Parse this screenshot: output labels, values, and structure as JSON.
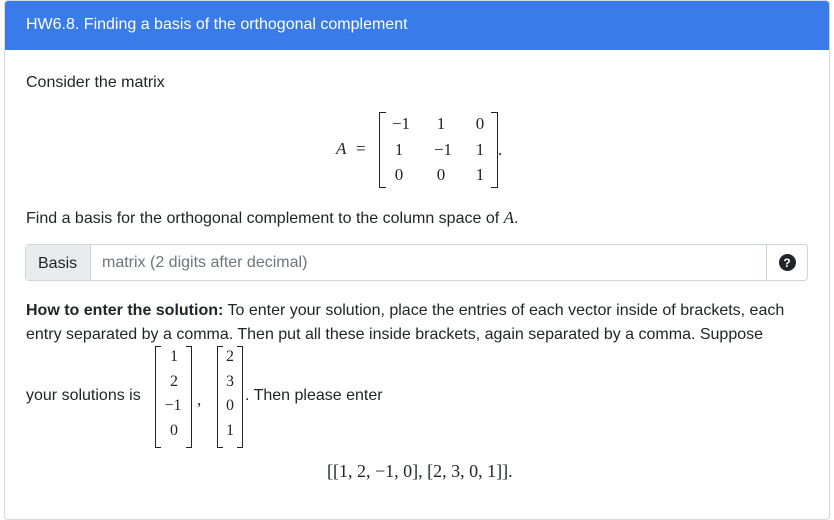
{
  "header": {
    "title": "HW6.8. Finding a basis of the orthogonal complement"
  },
  "problem": {
    "intro": "Consider the matrix",
    "matrix_symbol": "A",
    "equals": "=",
    "matrix_rows": [
      [
        "−1",
        "1",
        "0"
      ],
      [
        "1",
        "−1",
        "1"
      ],
      [
        "0",
        "0",
        "1"
      ]
    ],
    "period": ".",
    "question_text": "Find a basis for the orthogonal complement to the column space of",
    "question_symbol": "A",
    "question_period": "."
  },
  "answer": {
    "label": "Basis",
    "placeholder": "matrix (2 digits after decimal)",
    "help_icon": "question-circle-icon"
  },
  "instructions": {
    "bold_lead": "How to enter the solution:",
    "line1": "To enter your solution, place the entries of each vector inside of brackets, each",
    "line2": "entry separated by a comma. Then put all these inside brackets, again separated by a comma. Suppose",
    "solutions_text": "your solutions is",
    "vector1": [
      "1",
      "2",
      "−1",
      "0"
    ],
    "comma": ",",
    "vector2": [
      "2",
      "3",
      "0",
      "1"
    ],
    "then_text": ". Then please enter",
    "example": "[[1, 2, −1, 0], [2, 3, 0, 1]]."
  }
}
